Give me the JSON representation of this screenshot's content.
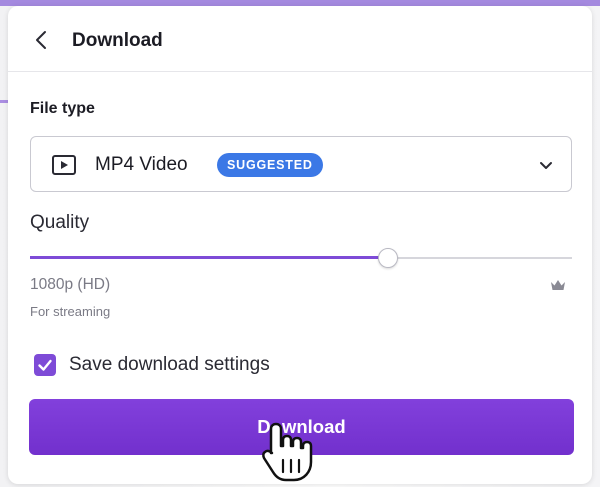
{
  "header": {
    "title": "Download"
  },
  "file_type": {
    "label": "File type",
    "selected": "MP4 Video",
    "badge": "SUGGESTED",
    "icon": "video-icon"
  },
  "quality": {
    "label": "Quality",
    "slider_value_fraction": 0.66,
    "resolution": "1080p (HD)",
    "description": "For streaming",
    "pro_icon": "crown-icon"
  },
  "save_settings": {
    "label": "Save download settings",
    "checked": true
  },
  "download_button": {
    "label": "Download"
  },
  "colors": {
    "accent": "#7a35d4",
    "badge": "#3b78e6"
  }
}
